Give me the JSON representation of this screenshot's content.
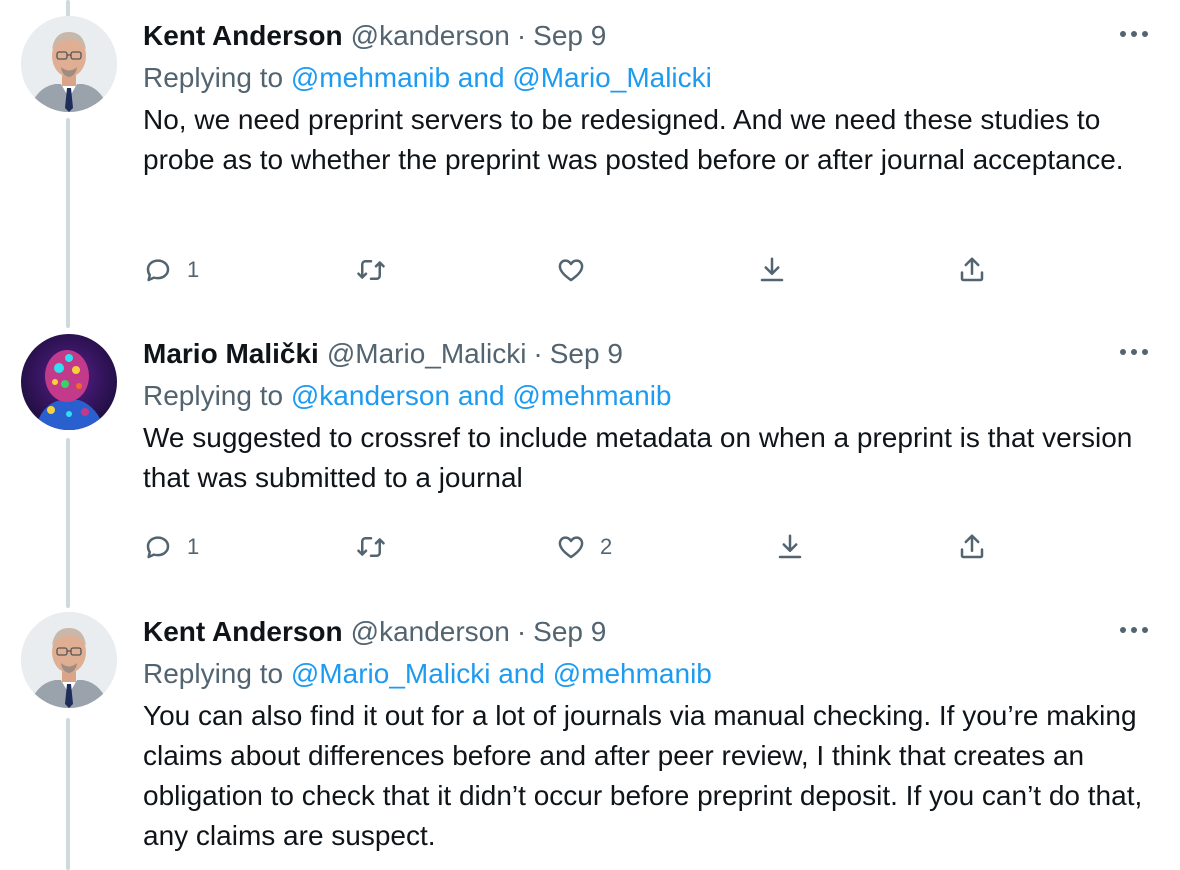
{
  "tweets": [
    {
      "name": "Kent Anderson",
      "handle": "@kanderson",
      "separator": "·",
      "date": "Sep 9",
      "replying_prefix": "Replying to",
      "replying_to": "@mehmanib and @Mario_Malicki",
      "text": "No, we need preprint servers to be redesigned. And we need these studies to probe as to whether the preprint was posted before or after journal acceptance.",
      "reply_count": "1",
      "retweet_count": "",
      "like_count": ""
    },
    {
      "name": "Mario Malički",
      "handle": "@Mario_Malicki",
      "separator": "·",
      "date": "Sep 9",
      "replying_prefix": "Replying to",
      "replying_to": "@kanderson and @mehmanib",
      "text": "We suggested to crossref to include metadata on when a preprint is that version that was submitted to a journal",
      "reply_count": "1",
      "retweet_count": "",
      "like_count": "2"
    },
    {
      "name": "Kent Anderson",
      "handle": "@kanderson",
      "separator": "·",
      "date": "Sep 9",
      "replying_prefix": "Replying to",
      "replying_to": "@Mario_Malicki and @mehmanib",
      "text": "You can also find it out for a lot of journals via manual checking. If you’re making claims about differences before and after peer review, I think that creates an obligation to check that it didn’t occur before preprint deposit. If you can’t do that, any claims are suspect."
    }
  ],
  "colors": {
    "link": "#1d9bf0",
    "secondary_text": "#536471",
    "thread_line": "#cfd9de",
    "primary_text": "#0f1419"
  },
  "icons": [
    "more-icon",
    "reply-icon",
    "retweet-icon",
    "like-icon",
    "download-icon",
    "share-icon"
  ]
}
